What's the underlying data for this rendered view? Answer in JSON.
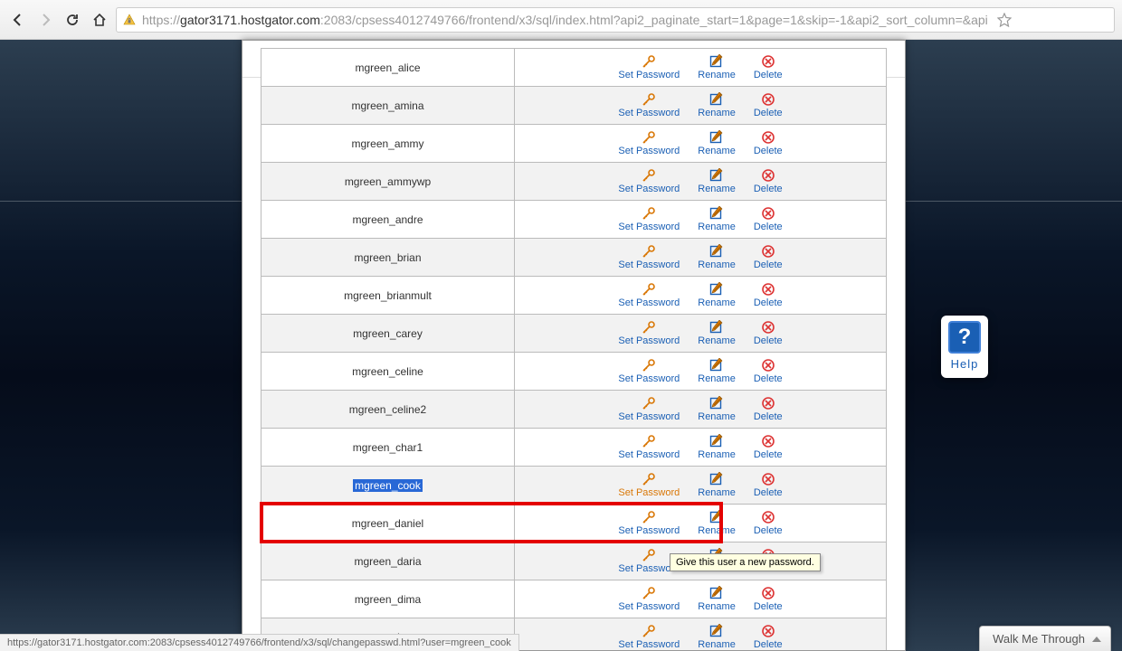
{
  "browser": {
    "url_domain": "gator3171.hostgator.com",
    "url_prefix": "https://",
    "url_port": ":2083",
    "url_path": "/cpsess4012749766/frontend/x3/sql/index.html?api2_paginate_start=1&page=1&skip=-1&api2_sort_column=&api",
    "status_text": "https://gator3171.hostgator.com:2083/cpsess4012749766/frontend/x3/sql/changepasswd.html?user=mgreen_cook"
  },
  "actions": {
    "set_password": "Set Password",
    "rename": "Rename",
    "delete": "Delete"
  },
  "tooltip": "Give this user a new password.",
  "help_label": "Help",
  "help_q": "?",
  "walkme": "Walk Me Through",
  "users": [
    {
      "name": "mgreen_alice"
    },
    {
      "name": "mgreen_amina"
    },
    {
      "name": "mgreen_ammy"
    },
    {
      "name": "mgreen_ammywp"
    },
    {
      "name": "mgreen_andre"
    },
    {
      "name": "mgreen_brian"
    },
    {
      "name": "mgreen_brianmult"
    },
    {
      "name": "mgreen_carey"
    },
    {
      "name": "mgreen_celine"
    },
    {
      "name": "mgreen_celine2"
    },
    {
      "name": "mgreen_char1"
    },
    {
      "name": "mgreen_cook",
      "highlighted": true,
      "set_pw_orange": true
    },
    {
      "name": "mgreen_daniel"
    },
    {
      "name": "mgreen_daria"
    },
    {
      "name": "mgreen_dima"
    },
    {
      "name": "mgreen_dream"
    }
  ],
  "colors": {
    "link": "#1a5fb4",
    "highlight_bg": "#2868d6",
    "red_box": "#e40000",
    "orange": "#d97706"
  }
}
